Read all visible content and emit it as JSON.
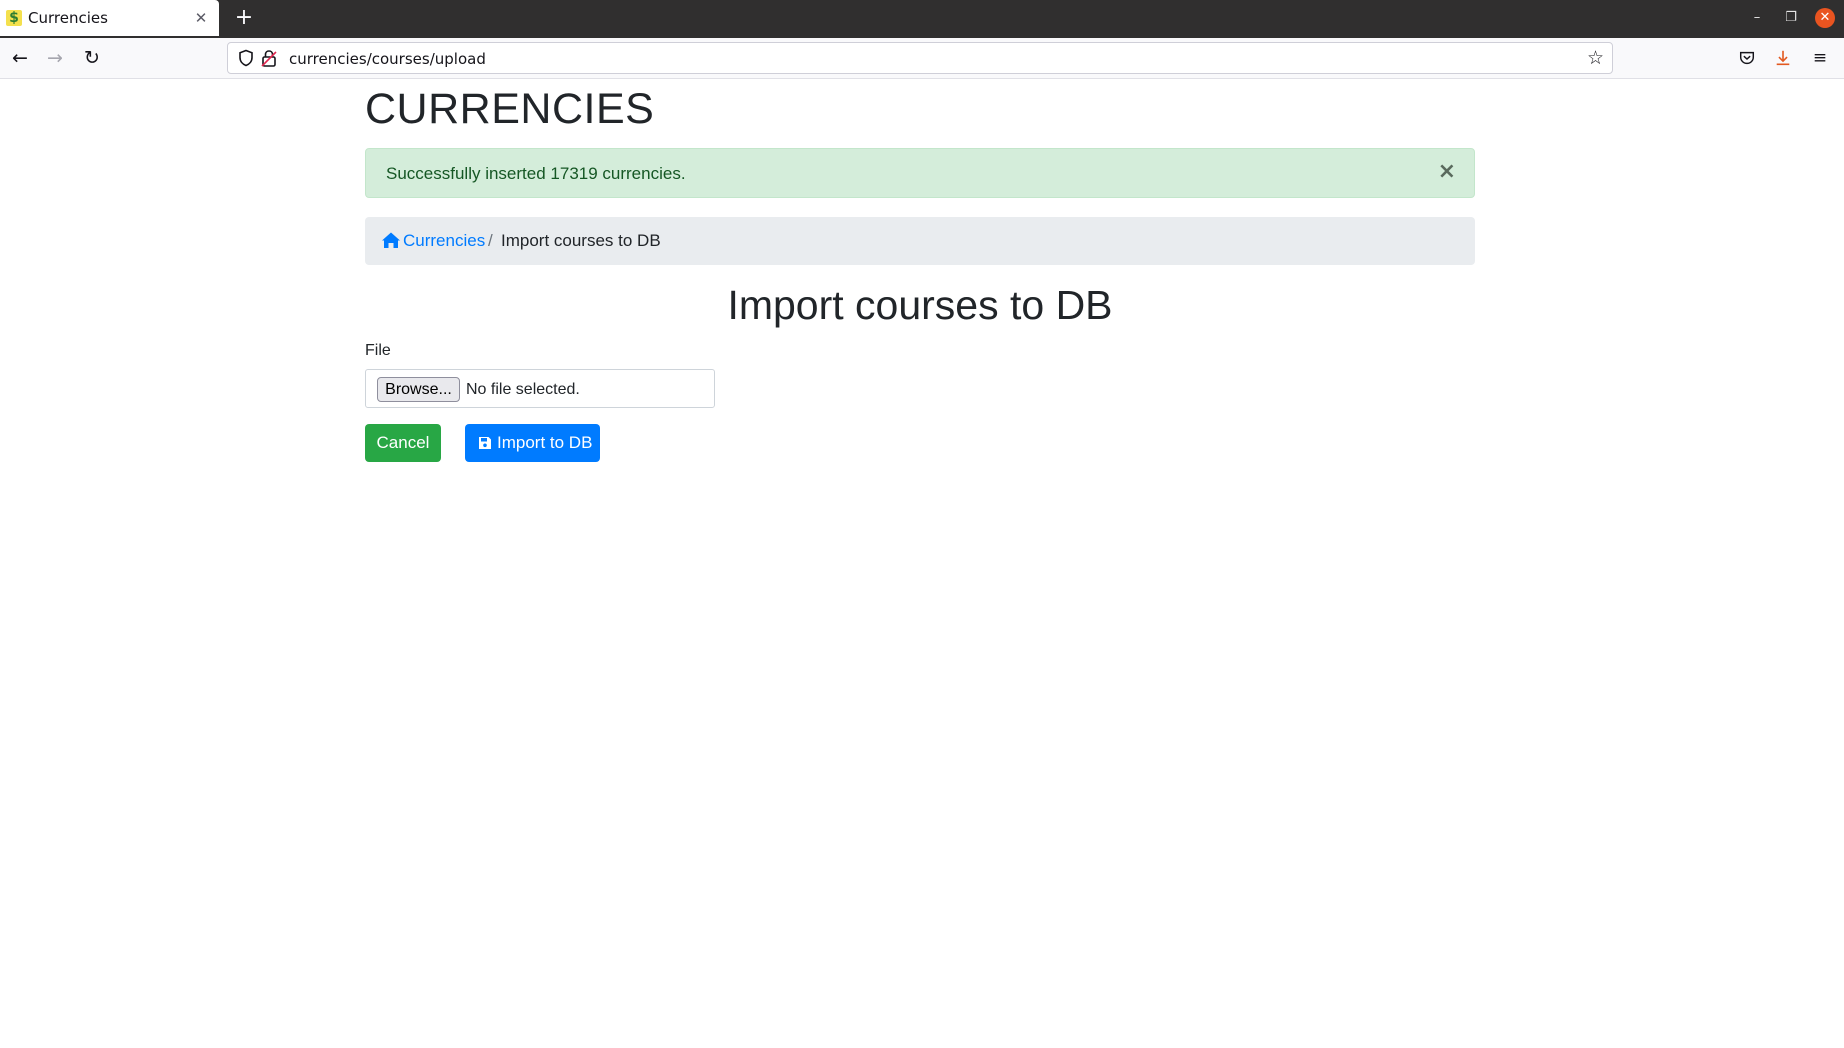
{
  "browser": {
    "tab": {
      "title": "Currencies",
      "favicon": "dollar-favicon",
      "close_icon": "close-icon"
    },
    "new_tab_icon": "plus-icon",
    "window_controls": [
      "minimize-icon",
      "restore-icon",
      "close-icon"
    ],
    "url": "currencies/courses/upload",
    "nav_icons": [
      "back-arrow-icon",
      "forward-arrow-icon",
      "reload-icon"
    ],
    "toolbar_icons": [
      "pocket-icon",
      "download-icon",
      "menu-icon"
    ]
  },
  "page": {
    "brand": "CURRENCIES",
    "alert": {
      "message": "Successfully inserted 17319 currencies.",
      "close": "×"
    },
    "breadcrumb": {
      "home_label": "Currencies",
      "separator": "/",
      "current": "Import courses to DB"
    },
    "title": "Import courses to DB",
    "form": {
      "file_label": "File",
      "browse_label": "Browse...",
      "file_status": "No file selected.",
      "cancel_label": "Cancel",
      "import_label": "Import to DB"
    }
  },
  "colors": {
    "success_bg": "#d4edda",
    "success_text": "#155724",
    "primary": "#007bff",
    "success_button": "#28a745",
    "breadcrumb_bg": "#e9ecef"
  }
}
